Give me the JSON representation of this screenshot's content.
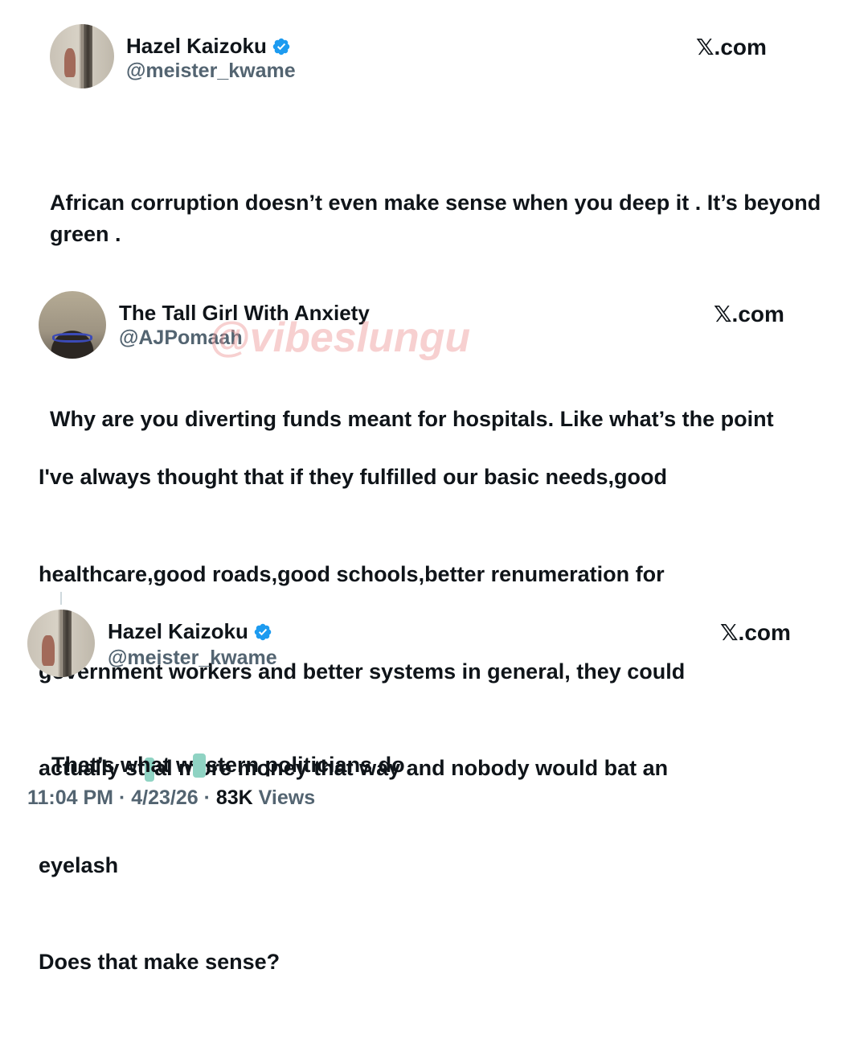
{
  "tweets": [
    {
      "name": "Hazel Kaizoku",
      "handle": "@meister_kwame",
      "site": "𝕏.com",
      "paragraphs": [
        "African corruption doesn’t even make sense when you deep it . It’s beyond green .",
        "Why are you diverting funds meant for hospitals. Like what’s the point"
      ]
    },
    {
      "name": "The Tall Girl With Anxiety",
      "handle": "@AJPomaah",
      "site": "𝕏.com",
      "line1": "I've always thought that if they fulfilled our basic needs,good",
      "line2": "healthcare,good roads,good schools,better renumeration for",
      "line3": "government workers and better systems in general, they could",
      "line4_pre": "actually st",
      "line4_post": "al more money that way and nobody would bat an",
      "line5": "eyelash",
      "line6": "Does that make sense?"
    },
    {
      "name": "Hazel Kaizoku",
      "handle": "@meister_kwame",
      "site": "𝕏.com",
      "text_pre": "That’s what w",
      "text_post": "stern politicians do",
      "time": "11:04 PM · 4/23/26 · ",
      "views_count": "83K",
      "views_label": " Views"
    }
  ],
  "watermark": "@vibeslungu",
  "colors": {
    "verified_blue": "#1d9bf0",
    "secondary_text": "#536471",
    "redaction": "#8fd3c3"
  },
  "icons": {
    "verified": "verified-badge-icon"
  }
}
